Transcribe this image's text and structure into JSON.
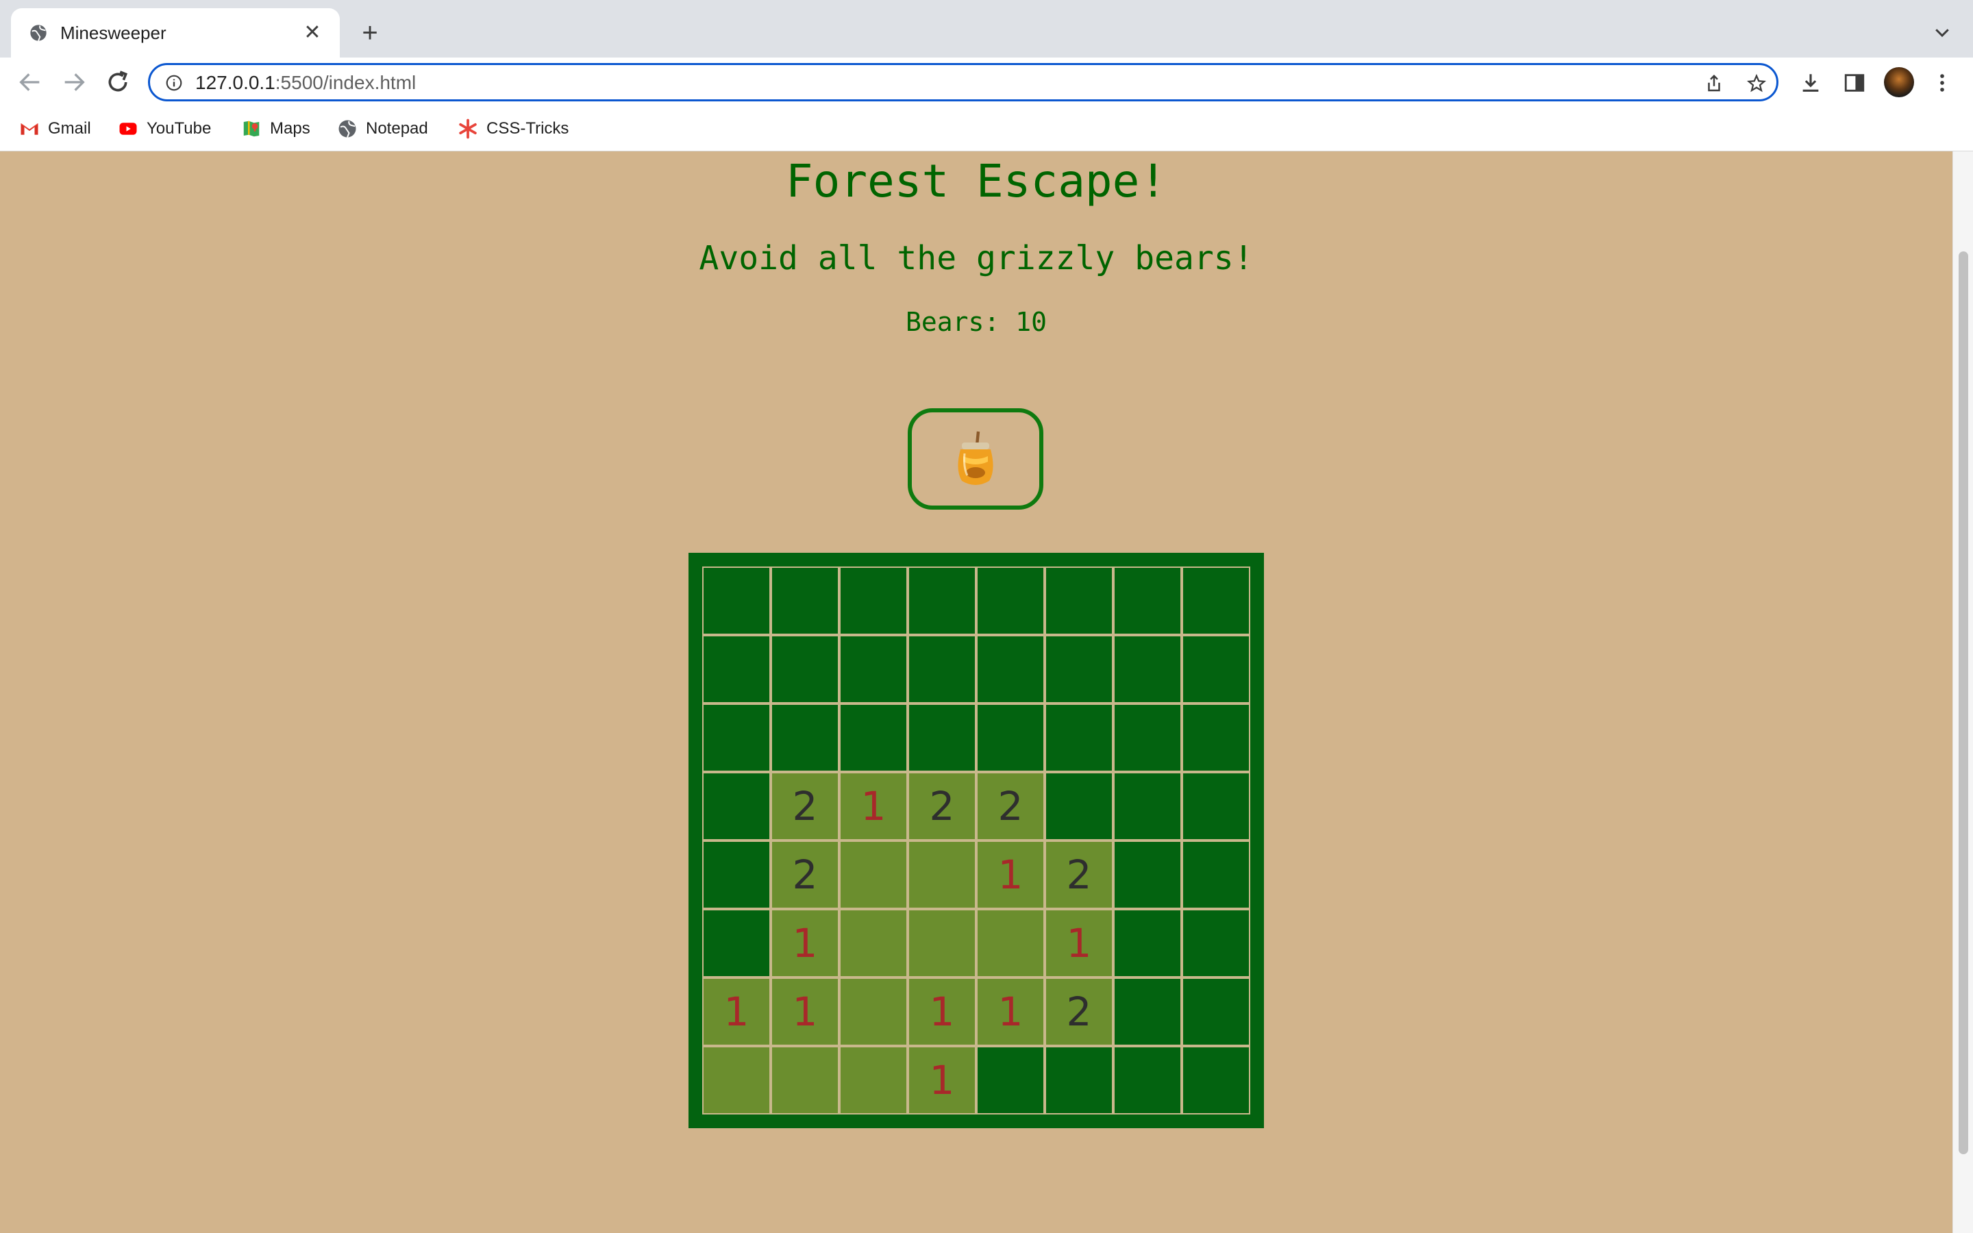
{
  "browser": {
    "tab_title": "Minesweeper",
    "url_host": "127.0.0.1",
    "url_rest": ":5500/index.html",
    "bookmarks": [
      "Gmail",
      "YouTube",
      "Maps",
      "Notepad",
      "CSS-Tricks"
    ]
  },
  "page": {
    "title": "Forest Escape!",
    "subtitle": "Avoid all the grizzly bears!",
    "bears_label": "Bears: 10",
    "reset_icon": "honey-pot-icon"
  },
  "board": {
    "rows": 8,
    "cols": 8,
    "cells": [
      [
        "#",
        "#",
        "#",
        "#",
        "#",
        "#",
        "#",
        "#"
      ],
      [
        "#",
        "#",
        "#",
        "#",
        "#",
        "#",
        "#",
        "#"
      ],
      [
        "#",
        "#",
        "#",
        "#",
        "#",
        "#",
        "#",
        "#"
      ],
      [
        "#",
        "2",
        "1",
        "2",
        "2",
        "#",
        "#",
        "#"
      ],
      [
        "#",
        "2",
        "",
        "",
        "1",
        "2",
        "#",
        "#"
      ],
      [
        "#",
        "1",
        "",
        "",
        "",
        "1",
        "#",
        "#"
      ],
      [
        "1",
        "1",
        "",
        "1",
        "1",
        "2",
        "#",
        "#"
      ],
      [
        "",
        "",
        "",
        "1",
        "#",
        "#",
        "#",
        "#"
      ]
    ]
  },
  "colors": {
    "background": "#d2b48c",
    "heading": "#006400",
    "hidden_cell": "#036310",
    "open_cell": "#6b8e2e",
    "number_1": "#a8282a",
    "number_2": "#2e2e2e"
  }
}
